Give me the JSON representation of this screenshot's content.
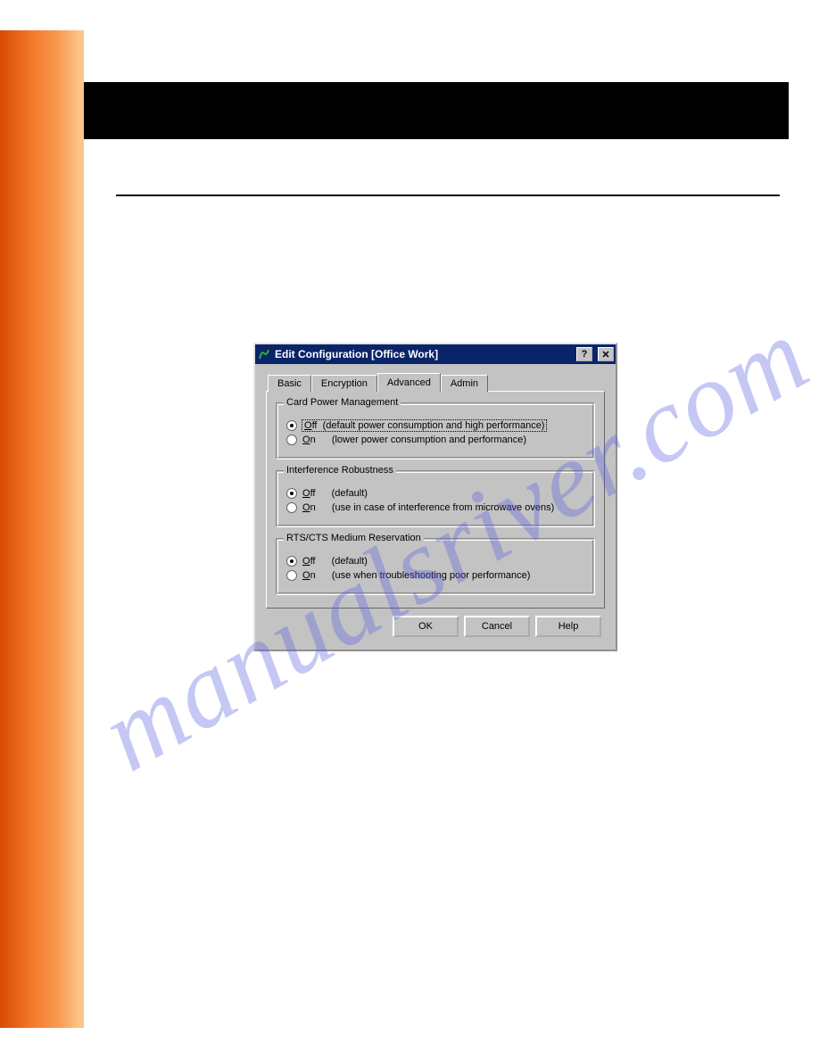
{
  "watermark": "manualsriver.com",
  "dialog": {
    "title": "Edit Configuration [Office Work]",
    "tabs": [
      {
        "label": "Basic",
        "active": false
      },
      {
        "label": "Encryption",
        "active": false
      },
      {
        "label": "Advanced",
        "active": true
      },
      {
        "label": "Admin",
        "active": false
      }
    ],
    "groups": {
      "power": {
        "legend": "Card Power Management",
        "off_label": "Off",
        "off_desc": "(default power consumption and high performance)",
        "on_label": "On",
        "on_desc": "(lower power consumption and performance)",
        "selected": "off",
        "focused": true
      },
      "interference": {
        "legend": "Interference Robustness",
        "off_label": "Off",
        "off_desc": "(default)",
        "on_label": "On",
        "on_desc": "(use in case of interference from microwave ovens)",
        "selected": "off"
      },
      "rts": {
        "legend": "RTS/CTS Medium Reservation",
        "off_label": "Off",
        "off_desc": "(default)",
        "on_label": "On",
        "on_desc": "(use when troubleshooting poor performance)",
        "selected": "off"
      }
    },
    "buttons": {
      "ok": "OK",
      "cancel": "Cancel",
      "help": "Help"
    }
  }
}
